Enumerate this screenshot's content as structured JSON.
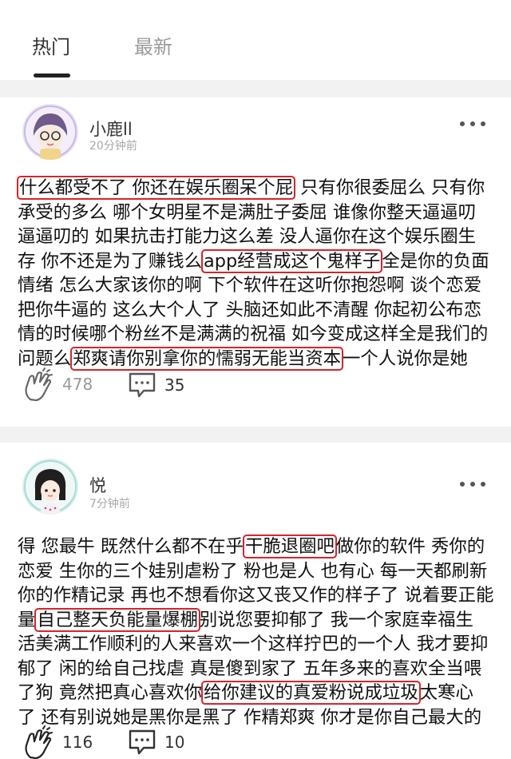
{
  "tabs": [
    {
      "label": "热门",
      "active": true
    },
    {
      "label": "最新",
      "active": false
    }
  ],
  "posts": [
    {
      "user": "小鹿ll",
      "time": "20分钟前",
      "avatar_icon": "girl-with-glasses-avatar",
      "lines": [
        [
          "",
          "什么都受不了 你还在娱乐圈呆个屁",
          " 只有你很委屈么 只有你"
        ],
        [
          "承受的多么 哪个女明星不是满肚子委屈 谁像你整天逼逼叨",
          "",
          ""
        ],
        [
          "逼逼叨的 如果抗击打能力这么差 没人逼你在这个娱乐圈生",
          "",
          ""
        ],
        [
          "存 你不还是为了赚钱么",
          "app经营成这个鬼样子",
          "全是你的负面"
        ],
        [
          "情绪 怎么大家该你的啊 下个软件在这听你抱怨啊 谈个恋爱",
          "",
          ""
        ],
        [
          "把你牛逼的 这么大个人了 头脑还如此不清醒 你起初公布恋",
          "",
          ""
        ],
        [
          "情的时候哪个粉丝不是满满的祝福 如今变成这样全是我们的",
          "",
          ""
        ],
        [
          "问题么",
          "郑爽请你别拿你的懦弱无能当资本",
          "一个人说你是她"
        ]
      ],
      "likes": "478",
      "comments": "35"
    },
    {
      "user": "悦",
      "time": "7分钟前",
      "avatar_icon": "cartoon-girl-avatar",
      "lines": [
        [
          "得 您最牛 既然什么都不在乎",
          "干脆退圈吧",
          "做你的软件 秀你的"
        ],
        [
          "恋爱 生你的三个娃别虐粉了 粉也是人 也有心 每一天都刷新",
          "",
          ""
        ],
        [
          "你的作精记录 再也不想看你这又丧又作的样子了 说着要正能",
          "",
          ""
        ],
        [
          "量",
          "自己整天负能量爆棚",
          "别说您要抑郁了 我一个家庭幸福生"
        ],
        [
          "活美满工作顺利的人来喜欢一个这样拧巴的一个人 我才要抑",
          "",
          ""
        ],
        [
          "郁了 闲的给自己找虐 真是傻到家了 五年多来的喜欢全当喂",
          "",
          ""
        ],
        [
          "了狗 竟然把真心喜欢你",
          "给你建议的真爱粉说成垃圾",
          "太寒心"
        ],
        [
          "了 还有别说她是黑你是黑了 作精郑爽 你才是你自己最大的",
          "",
          ""
        ]
      ],
      "likes": "116",
      "comments": "10"
    }
  ],
  "colors": {
    "highlight": "#d8232a",
    "muted": "#999999",
    "divider": "#f2f2f2"
  }
}
